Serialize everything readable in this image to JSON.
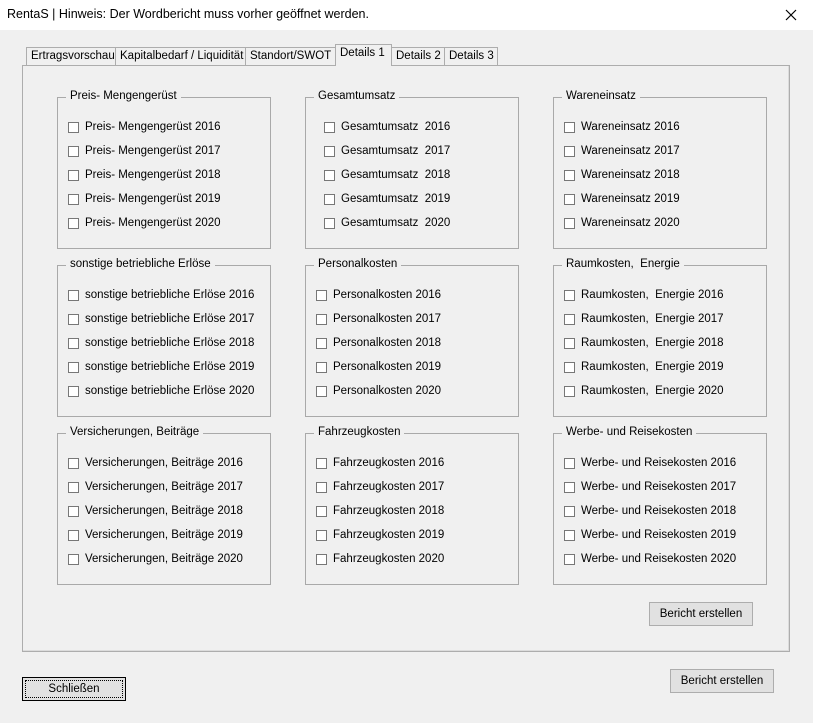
{
  "window": {
    "title": "RentaS | Hinweis: Der Wordbericht muss vorher geöffnet werden.",
    "close_icon": "close-icon"
  },
  "tabs": [
    {
      "label": "Ertragsvorschau",
      "active": false
    },
    {
      "label": "Kapitalbedarf / Liquidität",
      "active": false
    },
    {
      "label": "Standort/SWOT",
      "active": false
    },
    {
      "label": "Details 1",
      "active": true
    },
    {
      "label": "Details 2",
      "active": false
    },
    {
      "label": "Details 3",
      "active": false
    }
  ],
  "groups": [
    {
      "title": "Preis- Mengengerüst",
      "items": [
        "Preis- Mengengerüst 2016",
        "Preis- Mengengerüst 2017",
        "Preis- Mengengerüst 2018",
        "Preis- Mengengerüst 2019",
        "Preis- Mengengerüst 2020"
      ]
    },
    {
      "title": "Gesamtumsatz",
      "items": [
        "Gesamtumsatz  2016",
        "Gesamtumsatz  2017",
        "Gesamtumsatz  2018",
        "Gesamtumsatz  2019",
        "Gesamtumsatz  2020"
      ]
    },
    {
      "title": "Wareneinsatz",
      "items": [
        "Wareneinsatz 2016",
        "Wareneinsatz 2017",
        "Wareneinsatz 2018",
        "Wareneinsatz 2019",
        "Wareneinsatz 2020"
      ]
    },
    {
      "title": "sonstige betriebliche Erlöse",
      "items": [
        "sonstige betriebliche Erlöse 2016",
        "sonstige betriebliche Erlöse 2017",
        "sonstige betriebliche Erlöse 2018",
        "sonstige betriebliche Erlöse 2019",
        "sonstige betriebliche Erlöse 2020"
      ]
    },
    {
      "title": "Personalkosten",
      "items": [
        "Personalkosten 2016",
        "Personalkosten 2017",
        "Personalkosten 2018",
        "Personalkosten 2019",
        "Personalkosten 2020"
      ]
    },
    {
      "title": "Raumkosten,  Energie",
      "items": [
        "Raumkosten,  Energie 2016",
        "Raumkosten,  Energie 2017",
        "Raumkosten,  Energie 2018",
        "Raumkosten,  Energie 2019",
        "Raumkosten,  Energie 2020"
      ]
    },
    {
      "title": "Versicherungen, Beiträge",
      "items": [
        "Versicherungen, Beiträge 2016",
        "Versicherungen, Beiträge 2017",
        "Versicherungen, Beiträge 2018",
        "Versicherungen, Beiträge 2019",
        "Versicherungen, Beiträge 2020"
      ]
    },
    {
      "title": "Fahrzeugkosten",
      "items": [
        "Fahrzeugkosten 2016",
        "Fahrzeugkosten 2017",
        "Fahrzeugkosten 2018",
        "Fahrzeugkosten 2019",
        "Fahrzeugkosten 2020"
      ]
    },
    {
      "title": "Werbe- und Reisekosten",
      "items": [
        "Werbe- und Reisekosten 2016",
        "Werbe- und Reisekosten 2017",
        "Werbe- und Reisekosten 2018",
        "Werbe- und Reisekosten 2019",
        "Werbe- und Reisekosten 2020"
      ]
    }
  ],
  "buttons": {
    "panel_report": "Bericht erstellen",
    "report": "Bericht erstellen",
    "close": "Schließen"
  }
}
